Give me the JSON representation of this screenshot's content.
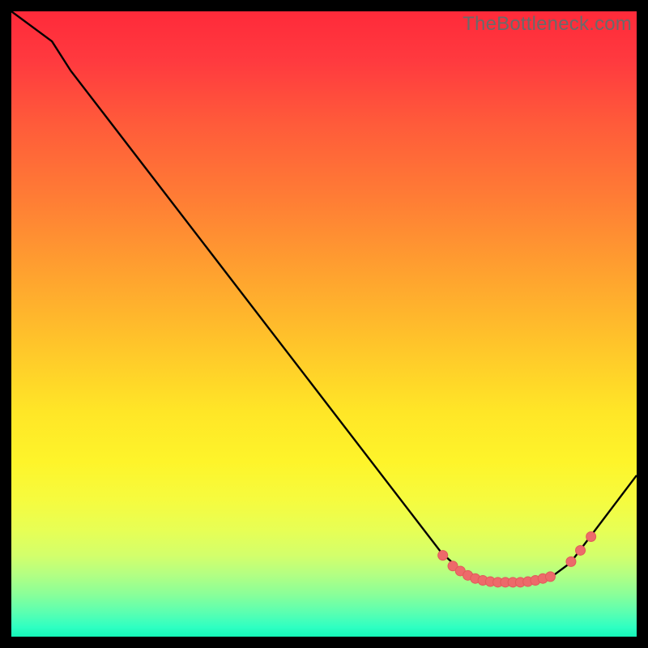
{
  "watermark": "TheBottleneck.com",
  "colors": {
    "curve_stroke": "#000000",
    "marker_fill": "#ed6a6a",
    "marker_stroke": "#e15a5a"
  },
  "chart_data": {
    "type": "line",
    "title": "",
    "xlabel": "",
    "ylabel": "",
    "xlim": [
      0,
      100
    ],
    "ylim": [
      0,
      100
    ],
    "grid": false,
    "curve_normalized_0to1": [
      {
        "x": 0.0,
        "y": 0.0
      },
      {
        "x": 0.065,
        "y": 0.048
      },
      {
        "x": 0.095,
        "y": 0.095
      },
      {
        "x": 0.688,
        "y": 0.866
      },
      {
        "x": 0.718,
        "y": 0.893
      },
      {
        "x": 0.76,
        "y": 0.91
      },
      {
        "x": 0.834,
        "y": 0.912
      },
      {
        "x": 0.867,
        "y": 0.902
      },
      {
        "x": 0.894,
        "y": 0.882
      },
      {
        "x": 1.0,
        "y": 0.742
      }
    ],
    "markers_normalized_0to1": [
      {
        "x": 0.69,
        "y": 0.87
      },
      {
        "x": 0.706,
        "y": 0.887
      },
      {
        "x": 0.718,
        "y": 0.895
      },
      {
        "x": 0.73,
        "y": 0.902
      },
      {
        "x": 0.742,
        "y": 0.907
      },
      {
        "x": 0.754,
        "y": 0.91
      },
      {
        "x": 0.766,
        "y": 0.912
      },
      {
        "x": 0.778,
        "y": 0.913
      },
      {
        "x": 0.79,
        "y": 0.913
      },
      {
        "x": 0.802,
        "y": 0.913
      },
      {
        "x": 0.814,
        "y": 0.913
      },
      {
        "x": 0.826,
        "y": 0.912
      },
      {
        "x": 0.838,
        "y": 0.91
      },
      {
        "x": 0.85,
        "y": 0.907
      },
      {
        "x": 0.862,
        "y": 0.904
      },
      {
        "x": 0.895,
        "y": 0.88
      },
      {
        "x": 0.91,
        "y": 0.862
      },
      {
        "x": 0.927,
        "y": 0.84
      }
    ],
    "marker_radius_px": 6
  }
}
